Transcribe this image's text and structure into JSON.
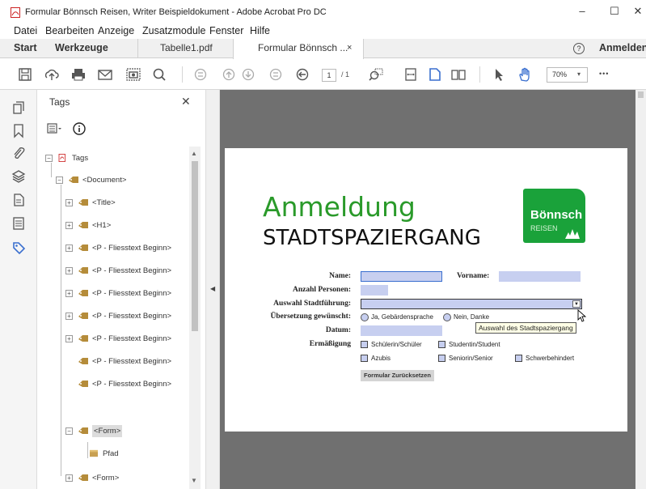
{
  "window": {
    "title": "Formular Bönnsch Reisen, Writer Beispieldokument - Adobe Acrobat Pro DC",
    "minimize": "–",
    "maximize": "☐",
    "close": "✕"
  },
  "menu": [
    "Datei",
    "Bearbeiten",
    "Anzeige",
    "Zusatzmodule",
    "Fenster",
    "Hilfe"
  ],
  "tabs": {
    "start": "Start",
    "tools": "Werkzeuge",
    "doc1": "Tabelle1.pdf",
    "doc2": "Formular Bönnsch ...",
    "close": "×",
    "help": "?",
    "signin": "Anmelden"
  },
  "toolbar": {
    "page_current": "1",
    "page_total": "/ 1",
    "zoom": "70%",
    "more": "•••"
  },
  "panel": {
    "title": "Tags",
    "close": "✕"
  },
  "tags": [
    {
      "label": "Tags"
    },
    {
      "label": "<Document>"
    },
    {
      "label": "<Title>"
    },
    {
      "label": "<H1>"
    },
    {
      "label": "<P - Fliesstext Beginn>"
    },
    {
      "label": "<P - Fliesstext Beginn>"
    },
    {
      "label": "<P - Fliesstext Beginn>"
    },
    {
      "label": "<P - Fliesstext Beginn>"
    },
    {
      "label": "<P - Fliesstext Beginn>"
    },
    {
      "label": "<P - Fliesstext Beginn>"
    },
    {
      "label": "<P - Fliesstext Beginn>"
    },
    {
      "label": "<Form>"
    },
    {
      "label": "Pfad"
    },
    {
      "label": "<Form>"
    }
  ],
  "doc": {
    "heading": "Anmeldung",
    "subheading": "STADTSPAZIERGANG",
    "logo_line1": "Bönnsch",
    "logo_line2": "REISEN",
    "name_label": "Name:",
    "vorname_label": "Vorname:",
    "anzahl_label": "Anzahl Personen:",
    "auswahl_label": "Auswahl Stadtführung:",
    "uebersetzung_label": "Übersetzung gewünscht:",
    "datum_label": "Datum:",
    "ermaessigung_label": "Ermäßigung",
    "radio_yes": "Ja, Gebärdensprache",
    "radio_no": "Nein, Danke",
    "tooltip": "Auswahl des Stadtspaziergang",
    "cb_schueler": "Schülerin/Schüler",
    "cb_student": "Studentin/Student",
    "cb_azubis": "Azubis",
    "cb_senior": "Seniorin/Senior",
    "cb_schwer": "Schwerbehindert",
    "reset_button": "Formular Zurücksetzen"
  },
  "colors": {
    "accent_green": "#2a9a2a",
    "logo_green": "#1aa23a",
    "field_fill": "#c7cff0"
  }
}
